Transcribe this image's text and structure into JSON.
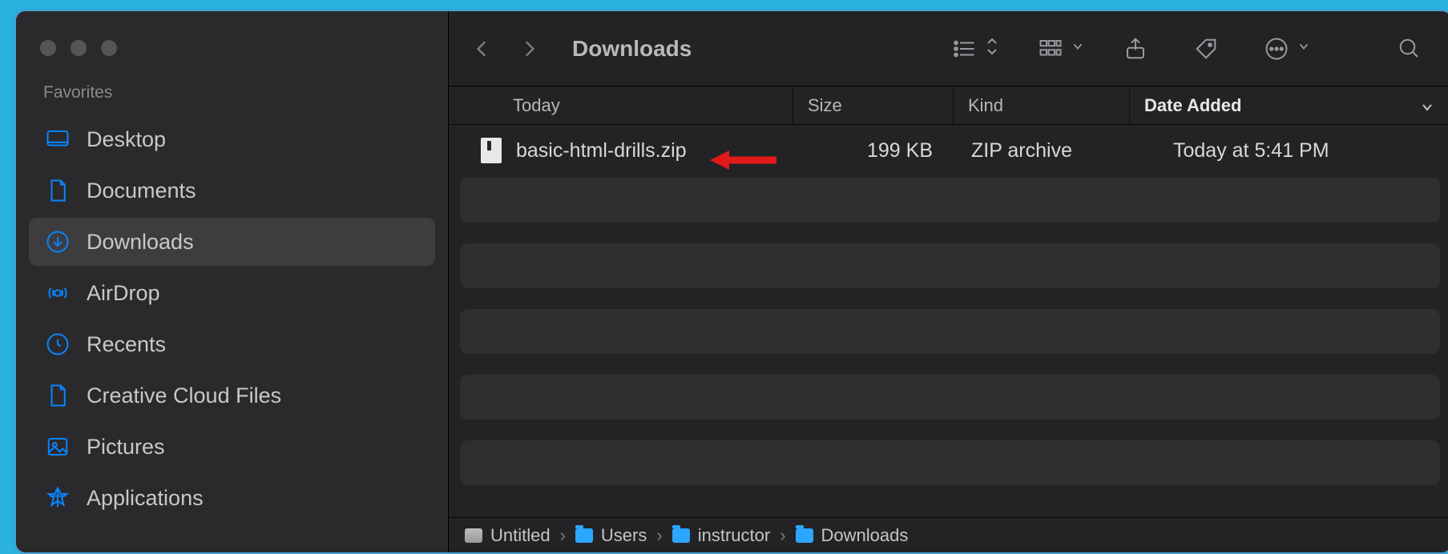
{
  "sidebar": {
    "section_label": "Favorites",
    "items": [
      {
        "label": "Desktop",
        "icon": "desktop"
      },
      {
        "label": "Documents",
        "icon": "document"
      },
      {
        "label": "Downloads",
        "icon": "download",
        "active": true
      },
      {
        "label": "AirDrop",
        "icon": "airdrop"
      },
      {
        "label": "Recents",
        "icon": "clock"
      },
      {
        "label": "Creative Cloud Files",
        "icon": "document"
      },
      {
        "label": "Pictures",
        "icon": "image"
      },
      {
        "label": "Applications",
        "icon": "app"
      }
    ]
  },
  "toolbar": {
    "title": "Downloads"
  },
  "columns": {
    "name": "Today",
    "size": "Size",
    "kind": "Kind",
    "date": "Date Added"
  },
  "rows": [
    {
      "name": "basic-html-drills.zip",
      "size": "199 KB",
      "kind": "ZIP archive",
      "date_added": "Today at 5:41 PM",
      "annotation_arrow": true
    }
  ],
  "path": [
    {
      "label": "Untitled",
      "icon": "drive"
    },
    {
      "label": "Users",
      "icon": "folder"
    },
    {
      "label": "instructor",
      "icon": "folder"
    },
    {
      "label": "Downloads",
      "icon": "folder"
    }
  ],
  "annotation": {
    "arrow_color": "#e11919"
  }
}
